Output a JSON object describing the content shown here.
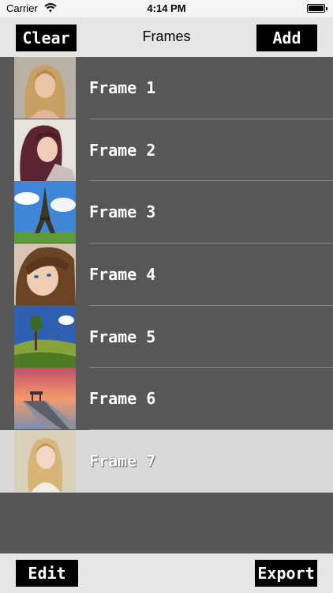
{
  "status_bar": {
    "carrier": "Carrier",
    "time": "4:14 PM",
    "wifi_icon": "wifi-icon",
    "battery_icon": "battery-icon"
  },
  "nav": {
    "title": "Frames",
    "left_button": "Clear",
    "right_button": "Add"
  },
  "frames": [
    {
      "label": "Frame 1",
      "image": "blonde-woman-portrait"
    },
    {
      "label": "Frame 2",
      "image": "woman-red-hair-portrait"
    },
    {
      "label": "Frame 3",
      "image": "eiffel-tower"
    },
    {
      "label": "Frame 4",
      "image": "woman-blue-eyes-portrait"
    },
    {
      "label": "Frame 5",
      "image": "green-landscape-tree"
    },
    {
      "label": "Frame 6",
      "image": "pier-sunset"
    },
    {
      "label": "Frame 7",
      "image": "blonde-woman-field",
      "selected": true
    }
  ],
  "toolbar": {
    "left_button": "Edit",
    "right_button": "Export"
  },
  "colors": {
    "background": "#585555",
    "bars": "#e6e6e6",
    "selected_row": "#d9d9d9",
    "button": "#000000"
  }
}
